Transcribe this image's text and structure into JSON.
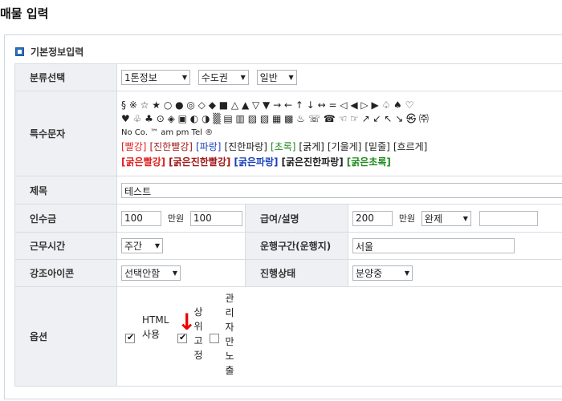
{
  "page": {
    "title": "매물 입력"
  },
  "section": {
    "label": "기본정보입력"
  },
  "category": {
    "label": "분류선택",
    "select1": "1톤정보",
    "select2": "수도권",
    "select3": "일반"
  },
  "special_chars": {
    "label": "특수문자",
    "line1": "§ ※ ☆ ★ ○ ● ◎ ◇ ◆ ■ △ ▲ ▽ ▼ → ← ↑ ↓ ↔ = ◁ ◀ ▷ ▶ ♤ ♠ ♡",
    "line2": "♥ ♧ ♣ ⊙ ◈ ▣ ◐ ◑ ▒ ▤ ▥ ▨ ▧ ▦ ▩ ♨ ☏ ☎ ☜ ☞ ↗ ↙ ↖ ↘ ㉿ ㈜",
    "line3": "No Co. ™ am pm Tel ®",
    "tags_row1": [
      {
        "text": "[빨강]",
        "color": "#e02020"
      },
      {
        "text": "[진한빨강]",
        "color": "#a01818"
      },
      {
        "text": "[파랑]",
        "color": "#1a3fb8"
      },
      {
        "text": "[진한파랑]",
        "color": "#222222"
      },
      {
        "text": "[초록]",
        "color": "#1f8a1f"
      },
      {
        "text": "[굵게]",
        "color": "#111111"
      },
      {
        "text": "[기울게]",
        "color": "#222222"
      },
      {
        "text": "[밑줄]",
        "color": "#222222"
      },
      {
        "text": "[흐르게]",
        "color": "#222222"
      }
    ],
    "tags_row2": [
      {
        "text": "[굵은빨강]",
        "color": "#e02020"
      },
      {
        "text": "[굵은진한빨강]",
        "color": "#a01818"
      },
      {
        "text": "[굵은파랑]",
        "color": "#1a3fb8"
      },
      {
        "text": "[굵은진한파랑]",
        "color": "#222222"
      },
      {
        "text": "[굵은초록]",
        "color": "#1f8a1f"
      }
    ]
  },
  "title_row": {
    "label": "제목",
    "value": "테스트"
  },
  "fee": {
    "label": "인수금",
    "value1": "100",
    "unit": "만원",
    "value2": "100"
  },
  "salary": {
    "label": "급여/설명",
    "value": "200",
    "unit": "만원",
    "select": "완제",
    "extra": ""
  },
  "work_time": {
    "label": "근무시간",
    "select": "주간"
  },
  "route": {
    "label": "운행구간(운행지)",
    "value": "서울"
  },
  "emphasis": {
    "label": "강조아이콘",
    "select": "선택안함"
  },
  "progress": {
    "label": "진행상태",
    "select": "분양중"
  },
  "options": {
    "label": "옵션",
    "html_label": "HTML 사용",
    "pin_label": "상위고정",
    "admin_label": "관리자만노출",
    "html_checked": true,
    "pin_checked": true,
    "admin_checked": false
  },
  "colors": {
    "accent": "#2b6fb8",
    "label_bg": "#eef0f3",
    "arrow": "#e00000"
  }
}
